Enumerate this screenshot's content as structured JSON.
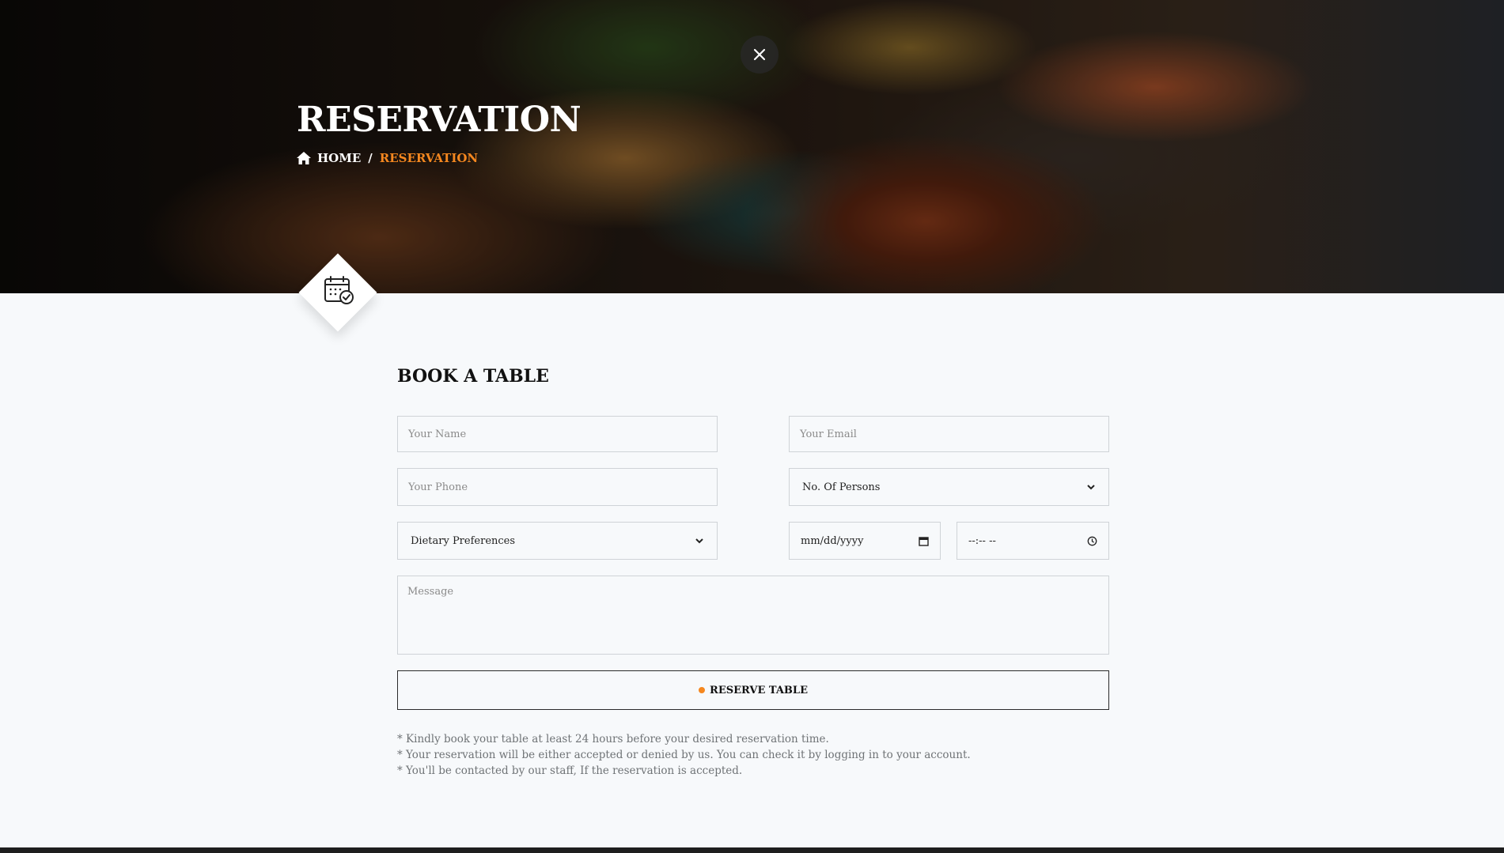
{
  "hero": {
    "title": "RESERVATION",
    "breadcrumb": {
      "home": "HOME",
      "separator": "/",
      "current": "RESERVATION"
    },
    "close_icon": "close-icon",
    "badge_icon": "calendar-check-icon"
  },
  "form": {
    "title": "BOOK A TABLE",
    "name_placeholder": "Your Name",
    "email_placeholder": "Your Email",
    "phone_placeholder": "Your Phone",
    "persons_selected": "No. Of Persons",
    "dietary_selected": "Dietary Preferences",
    "date_placeholder": "mm/dd/yyyy",
    "time_placeholder": "--:-- --",
    "message_placeholder": "Message",
    "submit_label": "RESERVE TABLE"
  },
  "notes": [
    "* Kindly book your table at least 24 hours before your desired reservation time.",
    "* Your reservation will be either accepted or denied by us. You can check it by logging in to your account.",
    "* You'll be contacted by our staff, If the reservation is accepted."
  ],
  "colors": {
    "accent": "#f5871f",
    "background": "#f7f9fb",
    "border": "#cfd3d7"
  }
}
